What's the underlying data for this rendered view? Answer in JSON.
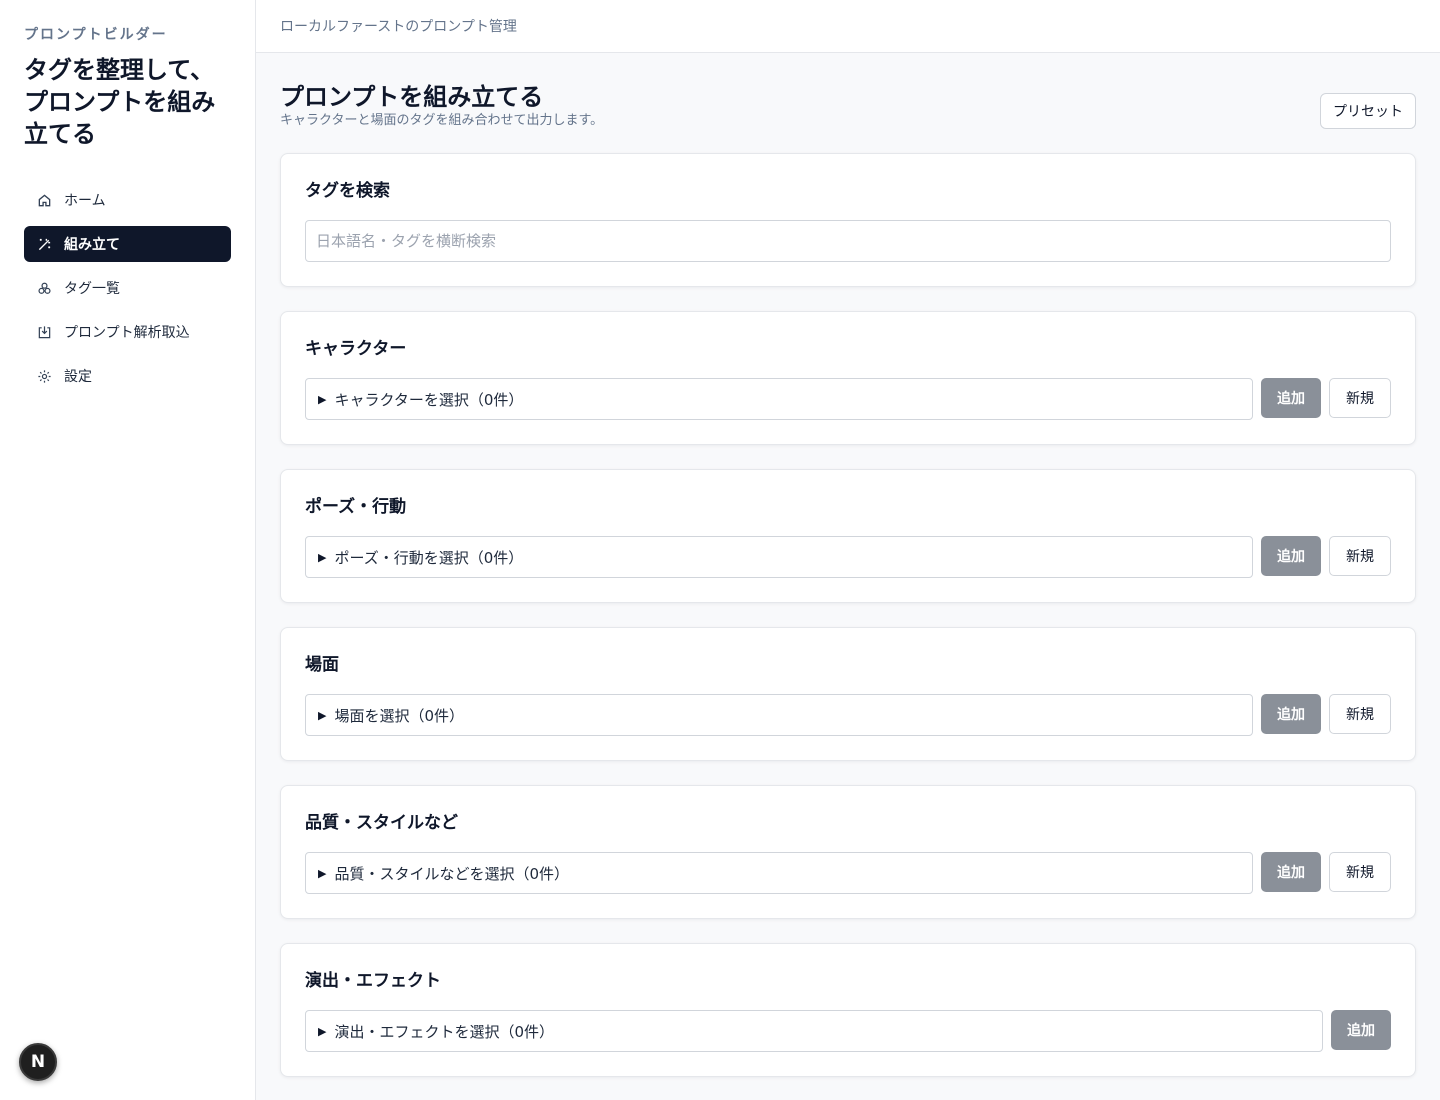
{
  "sidebar": {
    "app_label": "プロンプトビルダー",
    "app_title": "タグを整理して、プロンプトを組み立てる",
    "items": [
      {
        "label": "ホーム",
        "icon": "home-icon"
      },
      {
        "label": "組み立て",
        "icon": "wand-icon",
        "active": true
      },
      {
        "label": "タグ一覧",
        "icon": "tags-icon"
      },
      {
        "label": "プロンプト解析取込",
        "icon": "import-icon"
      },
      {
        "label": "設定",
        "icon": "gear-icon"
      }
    ],
    "badge": "N"
  },
  "topbar": {
    "breadcrumb": "ローカルファーストのプロンプト管理"
  },
  "page": {
    "title": "プロンプトを組み立てる",
    "subtitle": "キャラクターと場面のタグを組み合わせて出力します。",
    "preset_label": "プリセット"
  },
  "search": {
    "title": "タグを検索",
    "placeholder": "日本語名・タグを横断検索"
  },
  "sections": [
    {
      "title": "キャラクター",
      "select_label": "キャラクターを選択（0件）",
      "add_label": "追加",
      "new_label": "新規"
    },
    {
      "title": "ポーズ・行動",
      "select_label": "ポーズ・行動を選択（0件）",
      "add_label": "追加",
      "new_label": "新規"
    },
    {
      "title": "場面",
      "select_label": "場面を選択（0件）",
      "add_label": "追加",
      "new_label": "新規"
    },
    {
      "title": "品質・スタイルなど",
      "select_label": "品質・スタイルなどを選択（0件）",
      "add_label": "追加",
      "new_label": "新規"
    },
    {
      "title": "演出・エフェクト",
      "select_label": "演出・エフェクトを選択（0件）",
      "add_label": "追加"
    }
  ],
  "colors": {
    "accent": "#0f172a",
    "add_button": "#8a9099",
    "muted_text": "#64748b"
  }
}
